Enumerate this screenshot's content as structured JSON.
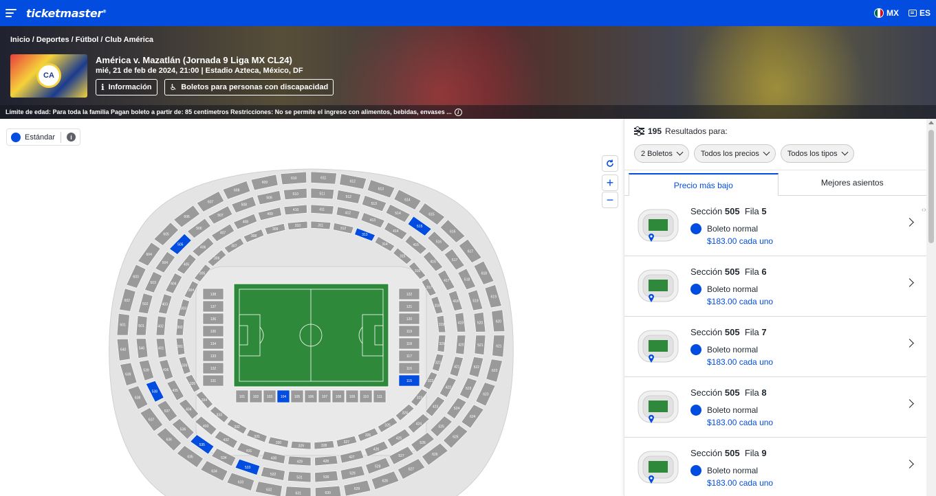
{
  "nav": {
    "brand": "ticketmaster",
    "brand_mark": "®",
    "country": "MX",
    "language": "ES"
  },
  "hero": {
    "breadcrumb": [
      "Inicio",
      "Deportes",
      "Fútbol",
      "Club América"
    ],
    "title": "América v. Mazatlán (Jornada 9 Liga MX CL24)",
    "subtitle": "mié, 21 de feb de 2024, 21:00 | Estadio Azteca, México, DF",
    "info_button": "Información",
    "accessibility_button": "Boletos para personas con discapacidad",
    "age_notice": "Límite de edad: Para toda la familia Pagan boleto a partir de: 85 centímetros Restricciones: No se permite el ingreso con alimentos, bebidas, envases ..."
  },
  "map": {
    "legend_label": "Estándar",
    "available_color": "#024ddf",
    "unavailable_color": "#9a9a9a",
    "available_sections": [
      "538",
      "535",
      "533",
      "115",
      "104",
      "505",
      "515",
      "313",
      "228"
    ]
  },
  "panel": {
    "results_count": "195",
    "results_label": "Resultados para:",
    "filters": [
      "2 Boletos",
      "Todos los precios",
      "Todos los tipos"
    ],
    "tabs": [
      "Precio más bajo",
      "Mejores asientos"
    ],
    "active_tab": 0,
    "listings": [
      {
        "section_label": "Sección",
        "section": "505",
        "row_label": "Fila",
        "row": "5",
        "type": "Boleto normal",
        "price": "$183.00 cada uno"
      },
      {
        "section_label": "Sección",
        "section": "505",
        "row_label": "Fila",
        "row": "6",
        "type": "Boleto normal",
        "price": "$183.00 cada uno"
      },
      {
        "section_label": "Sección",
        "section": "505",
        "row_label": "Fila",
        "row": "7",
        "type": "Boleto normal",
        "price": "$183.00 cada uno"
      },
      {
        "section_label": "Sección",
        "section": "505",
        "row_label": "Fila",
        "row": "8",
        "type": "Boleto normal",
        "price": "$183.00 cada uno"
      },
      {
        "section_label": "Sección",
        "section": "505",
        "row_label": "Fila",
        "row": "9",
        "type": "Boleto normal",
        "price": "$183.00 cada uno"
      }
    ]
  }
}
